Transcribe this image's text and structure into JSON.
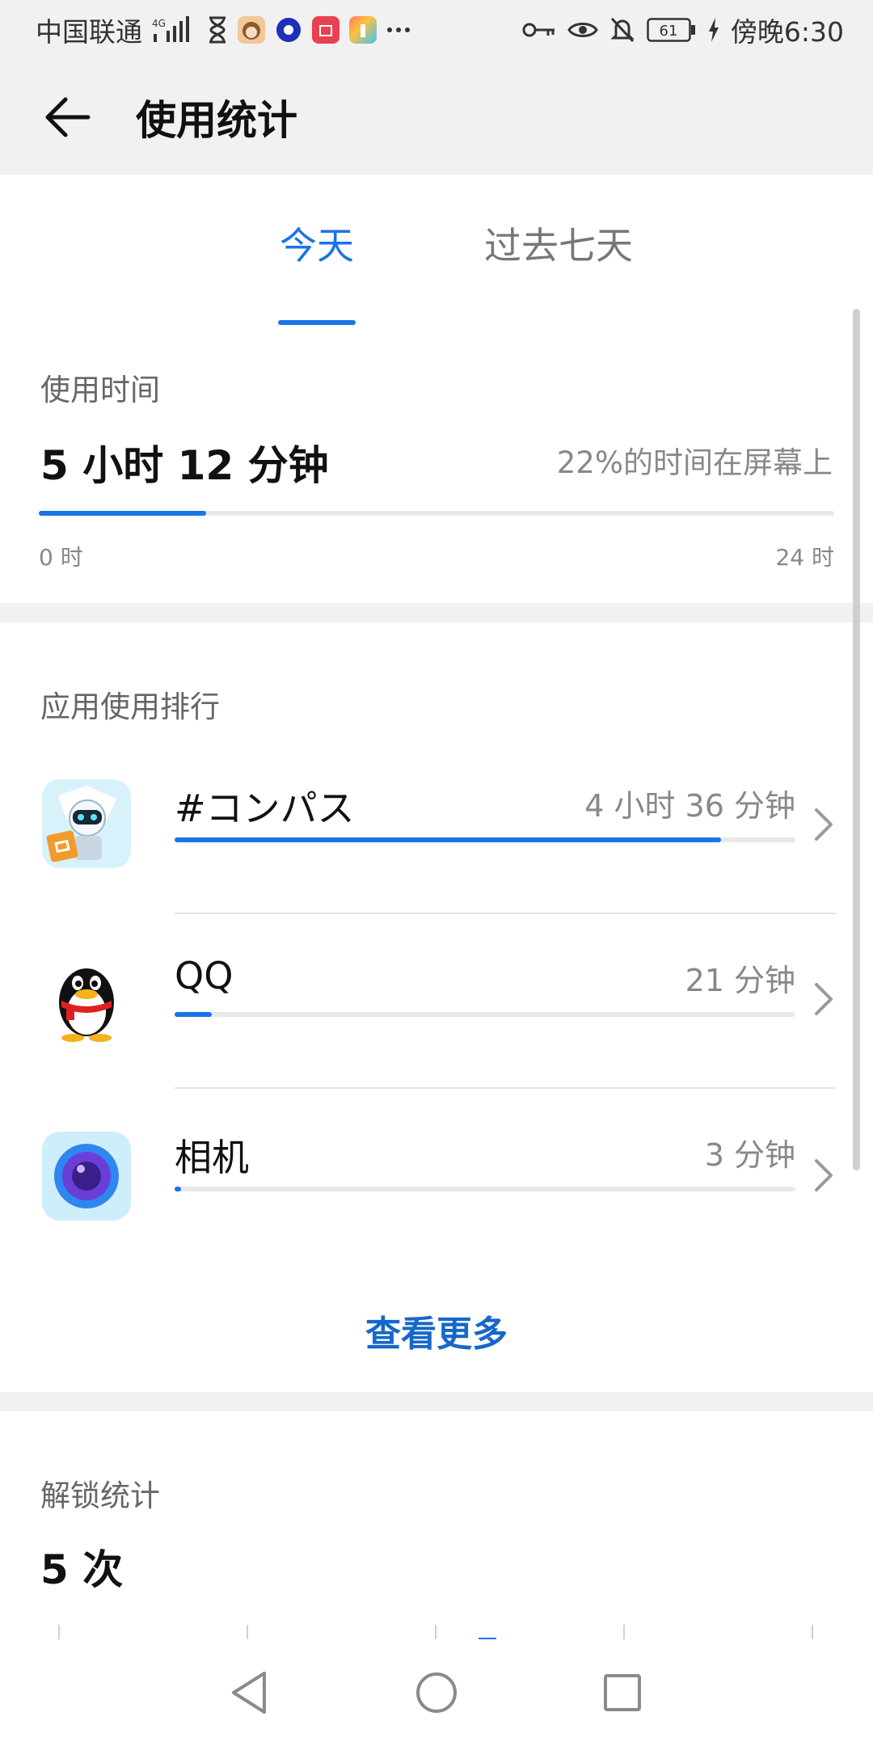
{
  "status_bar": {
    "carrier": "中国联通",
    "network": "4G",
    "battery": "61",
    "time": "傍晚6:30",
    "notifications_icon": "ellipsis-icon"
  },
  "header": {
    "title": "使用统计"
  },
  "tabs": {
    "today": "今天",
    "past_seven_days": "过去七天",
    "selected": "今天"
  },
  "usage_time": {
    "label": "使用时间",
    "value": "5 小时 12 分钟",
    "screen_percent_text": "22%的时间在屏幕上",
    "bar_fraction": 0.21,
    "axis_start": "0 时",
    "axis_end": "24 时"
  },
  "ranking": {
    "title": "应用使用排行",
    "apps": [
      {
        "name": "#コンパス",
        "time": "4 小时 36 分钟",
        "fraction": 0.88,
        "icon": "compass-game-icon"
      },
      {
        "name": "QQ",
        "time": "21 分钟",
        "fraction": 0.06,
        "icon": "qq-penguin-icon"
      },
      {
        "name": "相机",
        "time": "3 分钟",
        "fraction": 0.01,
        "icon": "camera-icon"
      }
    ],
    "see_more": "查看更多"
  },
  "unlock": {
    "label": "解锁统计",
    "value": "5 次"
  },
  "colors": {
    "accent": "#1a73e8",
    "link": "#1668c8",
    "background": "#f1f1f1"
  }
}
